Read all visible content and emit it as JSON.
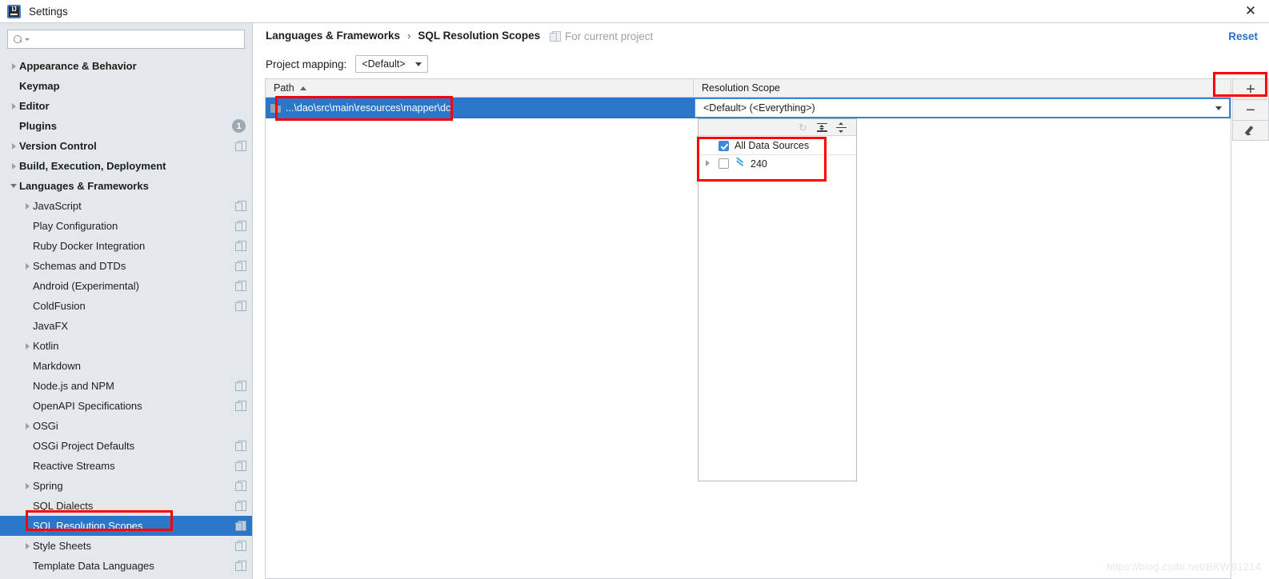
{
  "window": {
    "title": "Settings",
    "app_icon": "intellij-idea-icon",
    "close_label": "✕"
  },
  "search": {
    "value": "",
    "placeholder": "",
    "icon": "search-icon"
  },
  "sidebar": {
    "items": [
      {
        "label": "Appearance & Behavior",
        "bold": true,
        "indent": 0,
        "arrow": "right",
        "module_icon": false,
        "badge": null,
        "selected": false
      },
      {
        "label": "Keymap",
        "bold": true,
        "indent": 0,
        "arrow": "none",
        "module_icon": false,
        "badge": null,
        "selected": false
      },
      {
        "label": "Editor",
        "bold": true,
        "indent": 0,
        "arrow": "right",
        "module_icon": false,
        "badge": null,
        "selected": false
      },
      {
        "label": "Plugins",
        "bold": true,
        "indent": 0,
        "arrow": "none",
        "module_icon": false,
        "badge": "1",
        "selected": false
      },
      {
        "label": "Version Control",
        "bold": true,
        "indent": 0,
        "arrow": "right",
        "module_icon": true,
        "badge": null,
        "selected": false
      },
      {
        "label": "Build, Execution, Deployment",
        "bold": true,
        "indent": 0,
        "arrow": "right",
        "module_icon": false,
        "badge": null,
        "selected": false
      },
      {
        "label": "Languages & Frameworks",
        "bold": true,
        "indent": 0,
        "arrow": "down",
        "module_icon": false,
        "badge": null,
        "selected": false
      },
      {
        "label": "JavaScript",
        "bold": false,
        "indent": 1,
        "arrow": "right",
        "module_icon": true,
        "badge": null,
        "selected": false
      },
      {
        "label": "Play Configuration",
        "bold": false,
        "indent": 1,
        "arrow": "none",
        "module_icon": true,
        "badge": null,
        "selected": false
      },
      {
        "label": "Ruby Docker Integration",
        "bold": false,
        "indent": 1,
        "arrow": "none",
        "module_icon": true,
        "badge": null,
        "selected": false
      },
      {
        "label": "Schemas and DTDs",
        "bold": false,
        "indent": 1,
        "arrow": "right",
        "module_icon": true,
        "badge": null,
        "selected": false
      },
      {
        "label": "Android (Experimental)",
        "bold": false,
        "indent": 1,
        "arrow": "none",
        "module_icon": true,
        "badge": null,
        "selected": false
      },
      {
        "label": "ColdFusion",
        "bold": false,
        "indent": 1,
        "arrow": "none",
        "module_icon": true,
        "badge": null,
        "selected": false
      },
      {
        "label": "JavaFX",
        "bold": false,
        "indent": 1,
        "arrow": "none",
        "module_icon": false,
        "badge": null,
        "selected": false
      },
      {
        "label": "Kotlin",
        "bold": false,
        "indent": 1,
        "arrow": "right",
        "module_icon": false,
        "badge": null,
        "selected": false
      },
      {
        "label": "Markdown",
        "bold": false,
        "indent": 1,
        "arrow": "none",
        "module_icon": false,
        "badge": null,
        "selected": false
      },
      {
        "label": "Node.js and NPM",
        "bold": false,
        "indent": 1,
        "arrow": "none",
        "module_icon": true,
        "badge": null,
        "selected": false
      },
      {
        "label": "OpenAPI Specifications",
        "bold": false,
        "indent": 1,
        "arrow": "none",
        "module_icon": true,
        "badge": null,
        "selected": false
      },
      {
        "label": "OSGi",
        "bold": false,
        "indent": 1,
        "arrow": "right",
        "module_icon": false,
        "badge": null,
        "selected": false
      },
      {
        "label": "OSGi Project Defaults",
        "bold": false,
        "indent": 1,
        "arrow": "none",
        "module_icon": true,
        "badge": null,
        "selected": false
      },
      {
        "label": "Reactive Streams",
        "bold": false,
        "indent": 1,
        "arrow": "none",
        "module_icon": true,
        "badge": null,
        "selected": false
      },
      {
        "label": "Spring",
        "bold": false,
        "indent": 1,
        "arrow": "right",
        "module_icon": true,
        "badge": null,
        "selected": false
      },
      {
        "label": "SQL Dialects",
        "bold": false,
        "indent": 1,
        "arrow": "none",
        "module_icon": true,
        "badge": null,
        "selected": false
      },
      {
        "label": "SQL Resolution Scopes",
        "bold": false,
        "indent": 1,
        "arrow": "none",
        "module_icon": true,
        "badge": null,
        "selected": true
      },
      {
        "label": "Style Sheets",
        "bold": false,
        "indent": 1,
        "arrow": "right",
        "module_icon": true,
        "badge": null,
        "selected": false
      },
      {
        "label": "Template Data Languages",
        "bold": false,
        "indent": 1,
        "arrow": "none",
        "module_icon": true,
        "badge": null,
        "selected": false
      }
    ]
  },
  "main": {
    "breadcrumb": {
      "parent": "Languages & Frameworks",
      "separator": "›",
      "current": "SQL Resolution Scopes"
    },
    "for_current_project": "For current project",
    "reset_label": "Reset",
    "mapping": {
      "label": "Project mapping:",
      "value": "<Default>"
    },
    "table": {
      "headers": {
        "path": "Path",
        "scope": "Resolution Scope"
      },
      "sort_column": "Path",
      "sort_direction": "ascending",
      "rows": [
        {
          "path": "...\\dao\\src\\main\\resources\\mapper\\dc",
          "scope": "<Default> (<Everything>)",
          "selected": true
        }
      ]
    },
    "actions": {
      "add": "+",
      "remove": "−",
      "edit_icon": "pencil-icon"
    }
  },
  "popup": {
    "toolbar": {
      "refresh_icon": "refresh-icon",
      "expand_all_icon": "expand-all-icon",
      "collapse_all_icon": "collapse-all-icon"
    },
    "items": [
      {
        "label": "All Data Sources",
        "checked": true,
        "expandable": false,
        "icon": null
      },
      {
        "label": "240",
        "checked": false,
        "expandable": true,
        "icon": "data-source-icon"
      }
    ]
  },
  "watermark": "https://blog.csdn.net/BKWB1214",
  "colors": {
    "selection_blue": "#2a76c8",
    "sidebar_bg": "#e3e8ec",
    "annotation_red": "#ff0000",
    "link_blue": "#2a6fc9",
    "checkbox_blue": "#3a8ae0"
  }
}
